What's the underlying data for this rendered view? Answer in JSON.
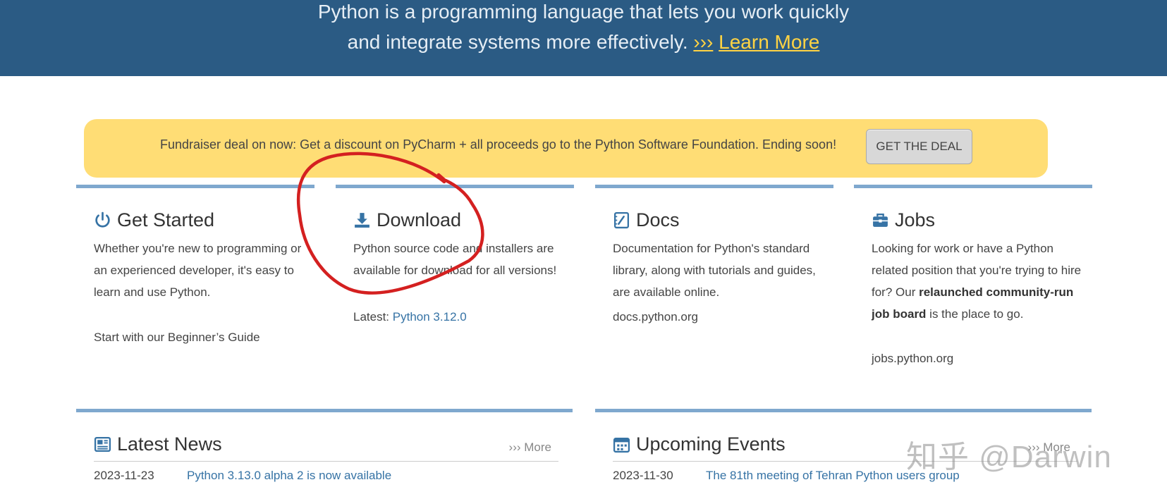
{
  "hero": {
    "line1": "Python is a programming language that lets you work quickly",
    "line2": "and integrate systems more effectively.",
    "chevron": "›››",
    "learn_more": "Learn More"
  },
  "banner": {
    "text": "Fundraiser deal on now: Get a discount on PyCharm + all proceeds go to the Python Software Foundation. Ending soon!",
    "button": "GET THE DEAL"
  },
  "widgets": {
    "get_started": {
      "title": "Get Started",
      "icon": "power-icon",
      "desc": "Whether you're new to programming or an experienced developer, it's easy to learn and use Python.",
      "link": "Start with our Beginner’s Guide"
    },
    "download": {
      "title": "Download",
      "icon": "download-icon",
      "desc": "Python source code and installers are available for download for all versions!",
      "latest_label": "Latest:",
      "latest_link": "Python 3.12.0"
    },
    "docs": {
      "title": "Docs",
      "icon": "docs-icon",
      "desc": "Documentation for Python's standard library, along with tutorials and guides, are available online.",
      "link": "docs.python.org"
    },
    "jobs": {
      "title": "Jobs",
      "icon": "briefcase-icon",
      "desc_pre": "Looking for work or have a Python related position that you're trying to hire for? Our ",
      "desc_bold": "relaunched community-run job board",
      "desc_post": " is the place to go.",
      "link": "jobs.python.org"
    }
  },
  "news": {
    "title": "Latest News",
    "more": "››› More",
    "items": [
      {
        "date": "2023-11-23",
        "title": "Python 3.13.0 alpha 2 is now available"
      }
    ]
  },
  "events": {
    "title": "Upcoming Events",
    "more": "››› More",
    "items": [
      {
        "date": "2023-11-30",
        "title": "The 81th meeting of Tehran Python users group"
      }
    ]
  },
  "watermark": "知乎 @Darwin",
  "colors": {
    "hero_bg": "#2b5b84",
    "accent_yellow": "#ffd343",
    "banner_bg": "#ffdd75",
    "widget_border": "#7fa8ce",
    "link": "#3673a5",
    "annotation_red": "#d42020"
  }
}
